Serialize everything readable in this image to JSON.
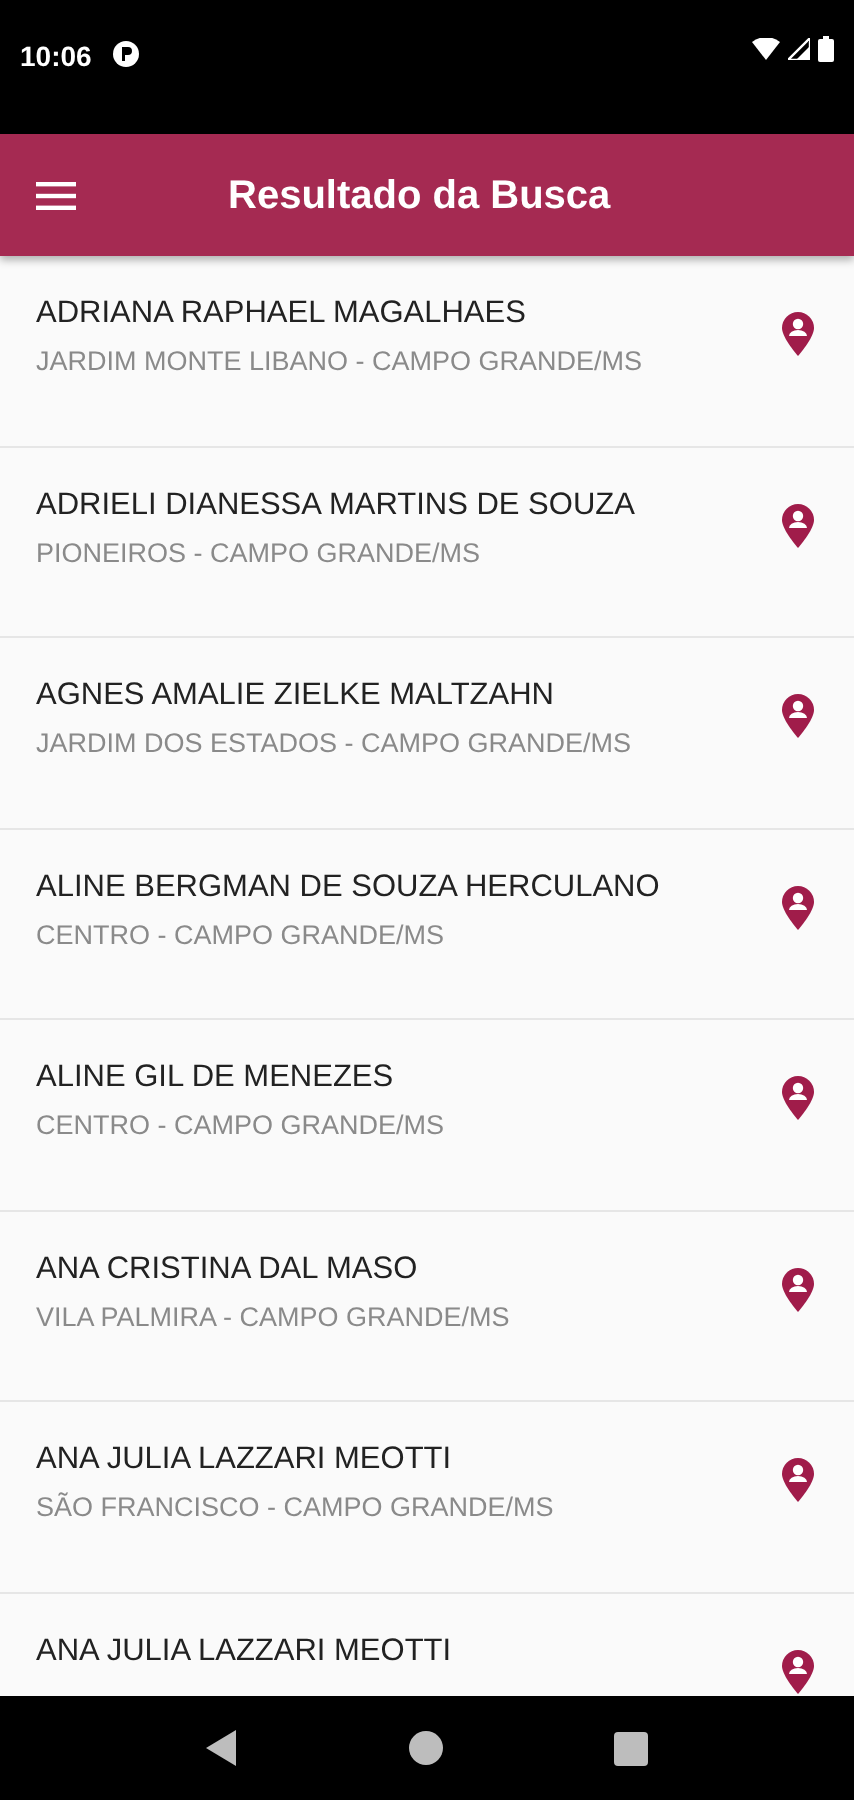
{
  "status_bar": {
    "time": "10:06"
  },
  "app_bar": {
    "title": "Resultado da Busca"
  },
  "results": [
    {
      "name": "ADRIANA RAPHAEL MAGALHAES",
      "location": "JARDIM MONTE LIBANO - CAMPO GRANDE/MS"
    },
    {
      "name": "ADRIELI DIANESSA MARTINS DE SOUZA",
      "location": "PIONEIROS - CAMPO GRANDE/MS"
    },
    {
      "name": "AGNES AMALIE ZIELKE MALTZAHN",
      "location": "JARDIM DOS ESTADOS - CAMPO GRANDE/MS"
    },
    {
      "name": "ALINE BERGMAN DE SOUZA HERCULANO",
      "location": "CENTRO - CAMPO GRANDE/MS"
    },
    {
      "name": "ALINE GIL DE MENEZES",
      "location": "CENTRO - CAMPO GRANDE/MS"
    },
    {
      "name": "ANA CRISTINA DAL MASO",
      "location": "VILA PALMIRA - CAMPO GRANDE/MS"
    },
    {
      "name": "ANA JULIA LAZZARI MEOTTI",
      "location": "SÃO FRANCISCO - CAMPO GRANDE/MS"
    },
    {
      "name": "ANA JULIA LAZZARI MEOTTI"
    }
  ]
}
